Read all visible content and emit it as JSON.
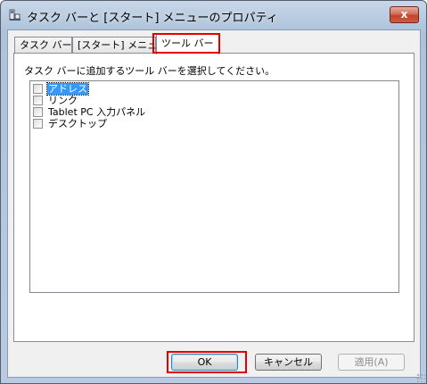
{
  "window": {
    "title": "タスク バーと [スタート] メニューのプロパティ",
    "close_glyph": "x"
  },
  "tabs": [
    {
      "label": "タスク バー",
      "active": false
    },
    {
      "label": "[スタート] メニュー",
      "active": false
    },
    {
      "label": "ツール バー",
      "active": true
    }
  ],
  "panel": {
    "instruction": "タスク バーに追加するツール バーを選択してください。",
    "toolbars": [
      {
        "label": "アドレス",
        "checked": false,
        "selected": true
      },
      {
        "label": "リンク",
        "checked": false,
        "selected": false
      },
      {
        "label": "Tablet PC 入力パネル",
        "checked": false,
        "selected": false
      },
      {
        "label": "デスクトップ",
        "checked": false,
        "selected": false
      }
    ]
  },
  "buttons": {
    "ok": "OK",
    "cancel": "キャンセル",
    "apply": "適用(A)"
  },
  "colors": {
    "highlight": "#e00000",
    "selection": "#3399ff"
  }
}
